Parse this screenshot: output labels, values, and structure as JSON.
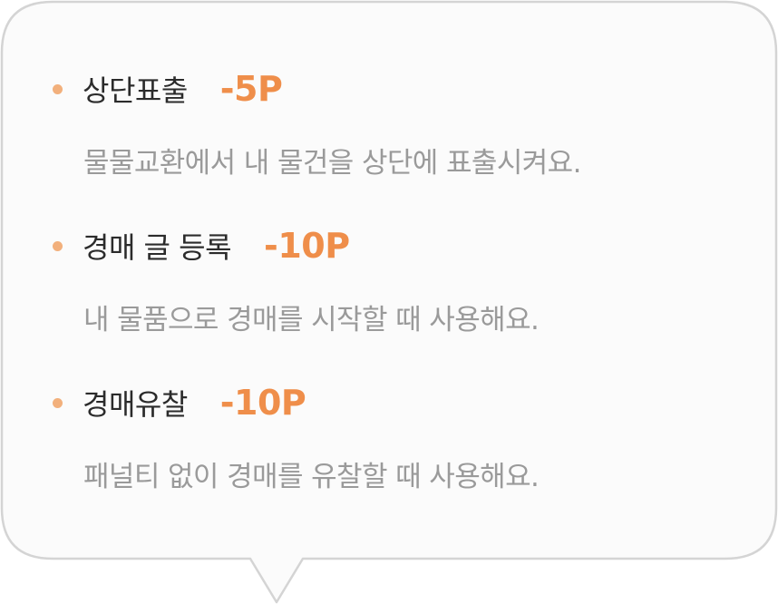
{
  "colors": {
    "bubble_fill": "#fbfbfb",
    "bubble_border": "#d4d4d4",
    "bullet": "#f2b07c",
    "cost": "#ef8e4a",
    "title": "#2b2b2b",
    "description": "#9a9a9a"
  },
  "items": [
    {
      "title": "상단표출",
      "cost": "-5P",
      "description": "물물교환에서 내 물건을 상단에 표출시켜요."
    },
    {
      "title": "경매 글 등록",
      "cost": "-10P",
      "description": "내 물품으로 경매를 시작할 때 사용해요."
    },
    {
      "title": "경매유찰",
      "cost": "-10P",
      "description": "패널티 없이 경매를 유찰할 때 사용해요."
    }
  ]
}
